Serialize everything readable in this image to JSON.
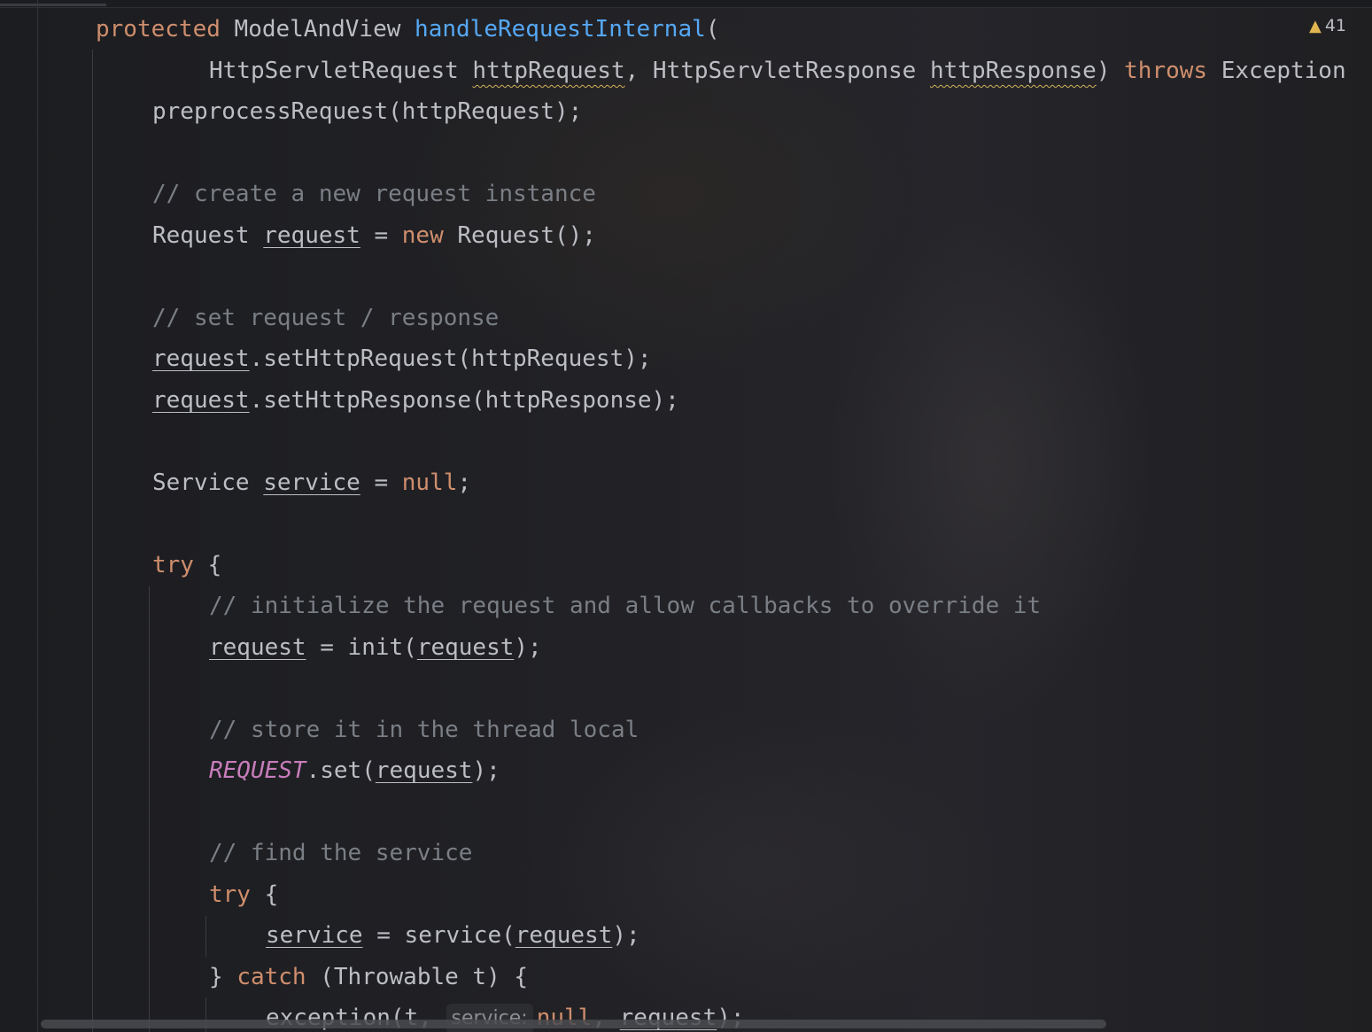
{
  "inspection": {
    "icon": "warning-triangle-icon",
    "glyph": "▲",
    "count": "41"
  },
  "hint": {
    "label": "service:"
  },
  "lines": [
    [
      [
        "kw",
        "protected"
      ],
      [
        "id",
        " ModelAndView "
      ],
      [
        "fn",
        "handleRequestInternal"
      ],
      [
        "id",
        "("
      ]
    ],
    [
      [
        "id",
        "HttpServletRequest "
      ],
      [
        "warn",
        "httpRequest"
      ],
      [
        "id",
        ", HttpServletResponse "
      ],
      [
        "warn",
        "httpResponse"
      ],
      [
        "id",
        ") "
      ],
      [
        "kw",
        "throws"
      ],
      [
        "id",
        " Exception"
      ]
    ],
    [
      [
        "id",
        "preprocessRequest(httpRequest);"
      ]
    ],
    [],
    [
      [
        "cm",
        "// create a new request instance"
      ]
    ],
    [
      [
        "id",
        "Request "
      ],
      [
        "var",
        "request"
      ],
      [
        "id",
        " = "
      ],
      [
        "kw",
        "new"
      ],
      [
        "id",
        " Request();"
      ]
    ],
    [],
    [
      [
        "cm",
        "// set request / response"
      ]
    ],
    [
      [
        "var",
        "request"
      ],
      [
        "id",
        ".setHttpRequest(httpRequest);"
      ]
    ],
    [
      [
        "var",
        "request"
      ],
      [
        "id",
        ".setHttpResponse(httpResponse);"
      ]
    ],
    [],
    [
      [
        "id",
        "Service "
      ],
      [
        "var",
        "service"
      ],
      [
        "id",
        " = "
      ],
      [
        "kw",
        "null"
      ],
      [
        "id",
        ";"
      ]
    ],
    [],
    [
      [
        "kw",
        "try"
      ],
      [
        "id",
        " {"
      ]
    ],
    [
      [
        "cm",
        "// initialize the request and allow callbacks to override it"
      ]
    ],
    [
      [
        "var",
        "request"
      ],
      [
        "id",
        " = init("
      ],
      [
        "var",
        "request"
      ],
      [
        "id",
        ");"
      ]
    ],
    [],
    [
      [
        "cm",
        "// store it in the thread local"
      ]
    ],
    [
      [
        "const",
        "REQUEST"
      ],
      [
        "id",
        ".set("
      ],
      [
        "var",
        "request"
      ],
      [
        "id",
        ");"
      ]
    ],
    [],
    [
      [
        "cm",
        "// find the service"
      ]
    ],
    [
      [
        "kw",
        "try"
      ],
      [
        "id",
        " {"
      ]
    ],
    [
      [
        "var",
        "service"
      ],
      [
        "id",
        " = service("
      ],
      [
        "var",
        "request"
      ],
      [
        "id",
        ");"
      ]
    ],
    [
      [
        "id",
        "} "
      ],
      [
        "kw",
        "catch"
      ],
      [
        "id",
        " (Throwable t) {"
      ]
    ],
    [
      [
        "id",
        "exception(t, "
      ],
      [
        "hint",
        ""
      ],
      [
        "kw",
        "null"
      ],
      [
        "id",
        ", "
      ],
      [
        "var",
        "request"
      ],
      [
        "id",
        ");"
      ]
    ]
  ]
}
